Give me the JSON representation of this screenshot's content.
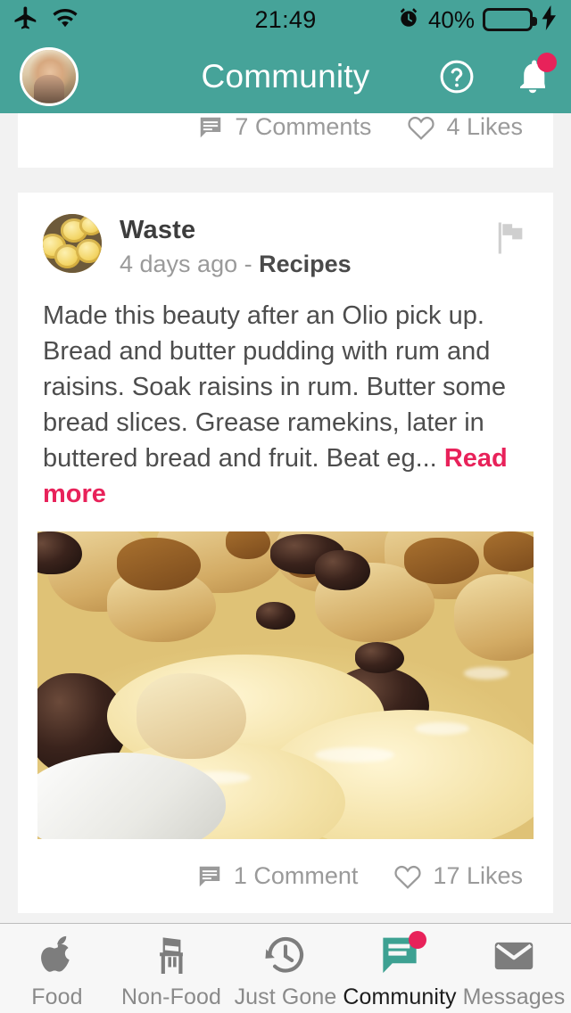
{
  "status_bar": {
    "airplane_icon": "airplane-icon",
    "wifi_icon": "wifi-icon",
    "time": "21:49",
    "alarm_icon": "alarm-clock-icon",
    "battery_percent": "40%",
    "battery_level": 40,
    "charging_icon": "lightning-bolt-icon"
  },
  "nav": {
    "avatar": "user-avatar",
    "title": "Community",
    "help_icon": "help-circle-icon",
    "notifications_icon": "bell-icon",
    "has_notifications": true,
    "background_color": "#46a399"
  },
  "feed": {
    "previous_post": {
      "comments": "7 Comments",
      "likes": "4 Likes"
    },
    "post": {
      "author": "Waste",
      "time_ago": "4 days ago",
      "separator": "-",
      "category": "Recipes",
      "report_icon": "flag-icon",
      "body": "Made this beauty after an Olio pick up. Bread and butter pudding with rum and raisins.   Soak raisins in rum. Butter some bread slices.  Grease ramekins, later in buttered bread and fruit. Beat eg...",
      "read_more": "Read more",
      "read_more_color": "#e8225a",
      "photo_alt": "bread-and-butter-pudding-photo",
      "comments": "1 Comment",
      "likes": "17 Likes"
    }
  },
  "tabbar": {
    "items": [
      {
        "label": "Food",
        "icon": "apple-icon",
        "active": false,
        "badge": false
      },
      {
        "label": "Non-Food",
        "icon": "chair-icon",
        "active": false,
        "badge": false
      },
      {
        "label": "Just Gone",
        "icon": "history-clock-icon",
        "active": false,
        "badge": false
      },
      {
        "label": "Community",
        "icon": "speech-bubble-icon",
        "active": true,
        "badge": true
      },
      {
        "label": "Messages",
        "icon": "envelope-icon",
        "active": false,
        "badge": false
      }
    ],
    "active_color": "#46a399",
    "inactive_color": "#7d7d7d",
    "badge_color": "#e8225a"
  }
}
